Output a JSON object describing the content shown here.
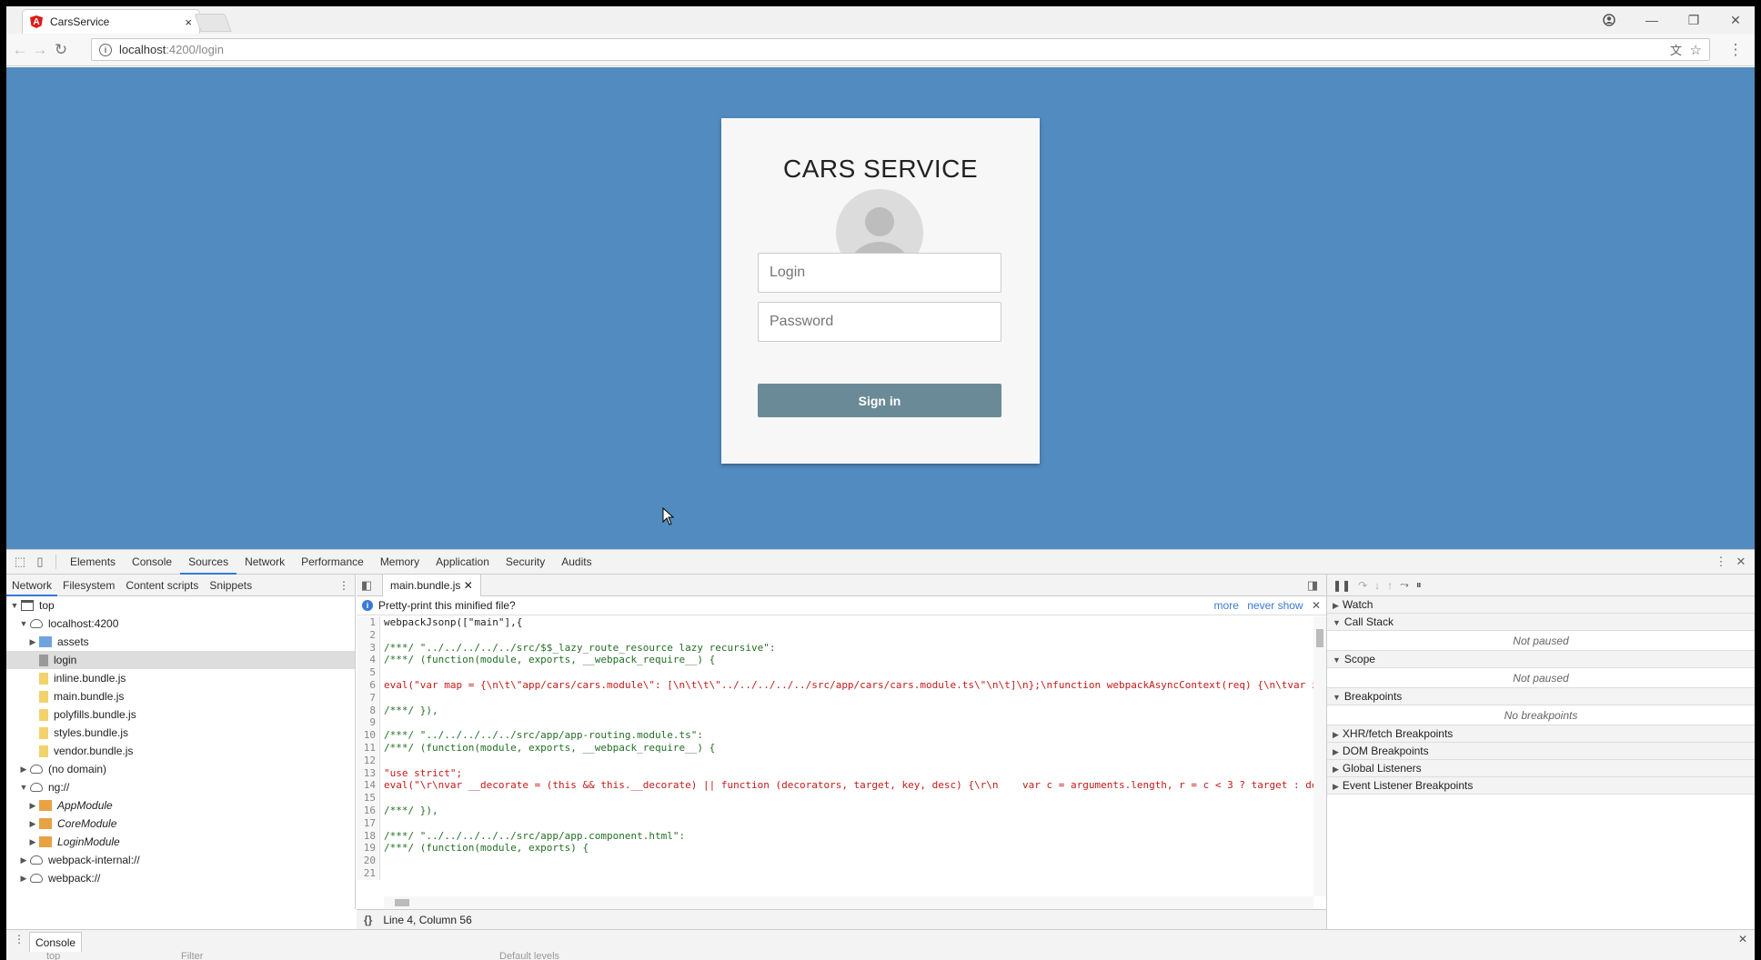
{
  "browser": {
    "tab_title": "CarsService",
    "tab_close": "×",
    "url_host": "localhost",
    "url_path": ":4200/login"
  },
  "page": {
    "title": "CARS SERVICE",
    "login_placeholder": "Login",
    "password_placeholder": "Password",
    "signin_label": "Sign in",
    "background_color": "#518bbf",
    "button_color": "#6b8a98"
  },
  "devtools": {
    "tabs": [
      "Elements",
      "Console",
      "Sources",
      "Network",
      "Performance",
      "Memory",
      "Application",
      "Security",
      "Audits"
    ],
    "active_tab": "Sources",
    "navigator_tabs": [
      "Network",
      "Filesystem",
      "Content scripts",
      "Snippets"
    ],
    "tree": [
      {
        "label": "top",
        "icon": "frame",
        "indent": 0,
        "arrow": "▼"
      },
      {
        "label": "localhost:4200",
        "icon": "cloud",
        "indent": 1,
        "arrow": "▼"
      },
      {
        "label": "assets",
        "icon": "folder-b",
        "indent": 2,
        "arrow": "▶"
      },
      {
        "label": "login",
        "icon": "file-g",
        "indent": 2,
        "arrow": "",
        "selected": true
      },
      {
        "label": "inline.bundle.js",
        "icon": "file-y",
        "indent": 2,
        "arrow": ""
      },
      {
        "label": "main.bundle.js",
        "icon": "file-y",
        "indent": 2,
        "arrow": ""
      },
      {
        "label": "polyfills.bundle.js",
        "icon": "file-y",
        "indent": 2,
        "arrow": ""
      },
      {
        "label": "styles.bundle.js",
        "icon": "file-y",
        "indent": 2,
        "arrow": ""
      },
      {
        "label": "vendor.bundle.js",
        "icon": "file-y",
        "indent": 2,
        "arrow": ""
      },
      {
        "label": "(no domain)",
        "icon": "cloud",
        "indent": 1,
        "arrow": "▶"
      },
      {
        "label": "ng://",
        "icon": "cloud",
        "indent": 1,
        "arrow": "▼"
      },
      {
        "label": "AppModule",
        "icon": "folder-o",
        "indent": 2,
        "arrow": "▶",
        "italic": true
      },
      {
        "label": "CoreModule",
        "icon": "folder-o",
        "indent": 2,
        "arrow": "▶",
        "italic": true
      },
      {
        "label": "LoginModule",
        "icon": "folder-o",
        "indent": 2,
        "arrow": "▶",
        "italic": true
      },
      {
        "label": "webpack-internal://",
        "icon": "cloud",
        "indent": 1,
        "arrow": "▶"
      },
      {
        "label": "webpack://",
        "icon": "cloud",
        "indent": 1,
        "arrow": "▶"
      }
    ],
    "editor": {
      "file_tab": "main.bundle.js",
      "infobar_text": "Pretty-print this minified file?",
      "infobar_more": "more",
      "infobar_never": "never show",
      "status": "Line 4, Column 56",
      "lines": [
        {
          "t": "webpackJsonp([\"main\"],{",
          "c": ""
        },
        {
          "t": "",
          "c": ""
        },
        {
          "t": "/***/ \"../../../../../src/$$_lazy_route_resource lazy recursive\":",
          "c": "cm"
        },
        {
          "t": "/***/ (function(module, exports, __webpack_require__) {",
          "c": "cm"
        },
        {
          "t": "",
          "c": ""
        },
        {
          "t": "eval(\"var map = {\\n\\t\\\"app/cars/cars.module\\\": [\\n\\t\\t\\\"../../../../../src/app/cars/cars.module.ts\\\"\\n\\t]\\n};\\nfunction webpackAsyncContext(req) {\\n\\tvar ids = map[req];\\n\\tif(!ids)\\n\\t\\tretu",
          "c": "st"
        },
        {
          "t": "",
          "c": ""
        },
        {
          "t": "/***/ }),",
          "c": "cm"
        },
        {
          "t": "",
          "c": ""
        },
        {
          "t": "/***/ \"../../../../../src/app/app-routing.module.ts\":",
          "c": "cm"
        },
        {
          "t": "/***/ (function(module, exports, __webpack_require__) {",
          "c": "cm"
        },
        {
          "t": "",
          "c": ""
        },
        {
          "t": "\"use strict\";",
          "c": "st"
        },
        {
          "t": "eval(\"\\r\\nvar __decorate = (this && this.__decorate) || function (decorators, target, key, desc) {\\r\\n    var c = arguments.length, r = c < 3 ? target : desc === null ? desc = Object.getOwnPr",
          "c": "st"
        },
        {
          "t": "",
          "c": ""
        },
        {
          "t": "/***/ }),",
          "c": "cm"
        },
        {
          "t": "",
          "c": ""
        },
        {
          "t": "/***/ \"../../../../../src/app/app.component.html\":",
          "c": "cm"
        },
        {
          "t": "/***/ (function(module, exports) {",
          "c": "cm"
        },
        {
          "t": "",
          "c": ""
        },
        {
          "t": "",
          "c": ""
        }
      ]
    },
    "debugger": {
      "watch": "Watch",
      "call_stack": "Call Stack",
      "call_stack_note": "Not paused",
      "scope": "Scope",
      "scope_note": "Not paused",
      "breakpoints": "Breakpoints",
      "breakpoints_note": "No breakpoints",
      "xhr": "XHR/fetch Breakpoints",
      "dom": "DOM Breakpoints",
      "global": "Global Listeners",
      "event": "Event Listener Breakpoints"
    },
    "drawer": {
      "tab": "Console",
      "context": "top",
      "filter_placeholder": "Filter",
      "levels": "Default levels"
    }
  }
}
